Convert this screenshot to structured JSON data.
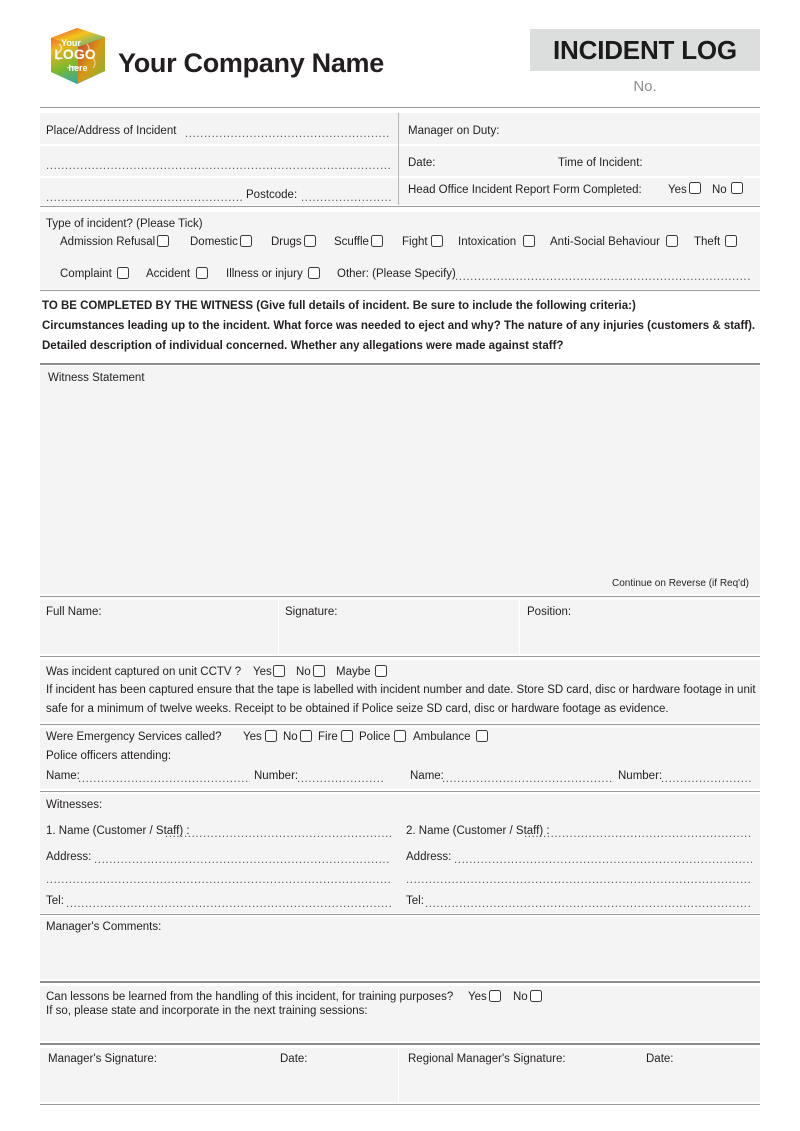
{
  "header": {
    "logo_alt": "Your LOGO here",
    "logo_line1": "Your",
    "logo_line2": "LOGO",
    "logo_line3": "here",
    "company_name": "Your Company Name",
    "badge_title": "INCIDENT LOG",
    "number_label": "No."
  },
  "dots": {
    "d1": "..........................................................................................................",
    "d2": "...............................................................................................................................................",
    "d3": "..............................................................................",
    "d4": ".....................................................",
    "d5": "............................................................................................................................................................................................",
    "d6": "..................................................................",
    "d7": ".................................",
    "d8": "............................................................................................................",
    "d9": "...................................................................................................................................",
    "d10": "..............................................................................................................................................."
  },
  "incident_info": {
    "place_label": "Place/Address of Incident",
    "postcode_label": "Postcode:",
    "manager_on_duty_label": "Manager on Duty:",
    "date_label": "Date:",
    "time_label": "Time of Incident:",
    "head_office_label": "Head Office Incident Report Form Completed:",
    "yes_label": "Yes",
    "no_label": "No"
  },
  "incident_type": {
    "title": "Type of incident? (Please Tick)",
    "row1": [
      {
        "label": "Admission Refusal"
      },
      {
        "label": "Domestic"
      },
      {
        "label": "Drugs"
      },
      {
        "label": "Scuffle"
      },
      {
        "label": "Fight"
      },
      {
        "label": "Intoxication"
      },
      {
        "label": "Anti-Social Behaviour"
      },
      {
        "label": "Theft"
      }
    ],
    "row2": [
      {
        "label": "Complaint"
      },
      {
        "label": "Accident"
      },
      {
        "label": "Illness or injury"
      }
    ],
    "other_label": "Other: (Please Specify)"
  },
  "instructions": {
    "line1": "TO BE COMPLETED BY THE WITNESS (Give full details of incident. Be sure to include the following criteria:)",
    "line2": "Circumstances leading up to the incident. What force was needed to eject and why? The nature of any injuries (customers & staff).",
    "line3": "Detailed description of individual concerned. Whether any allegations were made against staff?"
  },
  "witness_statement": {
    "title": "Witness Statement",
    "continue_note": "Continue on Reverse (if Req'd)"
  },
  "signature_row": {
    "full_name_label": "Full Name:",
    "signature_label": "Signature:",
    "position_label": "Position:"
  },
  "cctv": {
    "question": "Was incident captured on unit CCTV ?",
    "options": [
      {
        "label": "Yes"
      },
      {
        "label": "No"
      },
      {
        "label": "Maybe"
      }
    ],
    "note_line1": "If incident has been captured ensure that the tape is labelled with incident number and date. Store SD card, disc or hardware footage in unit",
    "note_line2": "safe for a minimum of twelve weeks. Receipt to be obtained if Police seize SD card, disc or hardware footage as evidence."
  },
  "emergency": {
    "question": "Were Emergency Services called?",
    "options": [
      {
        "label": "Yes"
      },
      {
        "label": "No"
      },
      {
        "label": "Fire"
      },
      {
        "label": "Police"
      },
      {
        "label": "Ambulance"
      }
    ],
    "officers_label": "Police officers attending:",
    "name_label": "Name:",
    "number_label": "Number:"
  },
  "witnesses": {
    "title": "Witnesses:",
    "entry1_label": "1. Name (Customer / Staff) :",
    "entry2_label": "2. Name (Customer / Staff) :",
    "address_label": "Address:",
    "tel_label": "Tel:"
  },
  "manager_comments": {
    "title": "Manager's Comments:"
  },
  "lessons": {
    "question": "Can lessons be learned from the handling of this incident, for training purposes?",
    "yes_label": "Yes",
    "no_label": "No",
    "followup": "If so, please state and incorporate in the next training sessions:"
  },
  "final_signatures": {
    "manager_signature_label": "Manager's Signature:",
    "manager_date_label": "Date:",
    "regional_signature_label": "Regional Manager's Signature:",
    "regional_date_label": "Date:"
  },
  "colors": {
    "panel_bg": "#f4f4f4",
    "badge_bg": "#dcdddd",
    "rule": "#9a9a9a",
    "text": "#231f20",
    "muted": "#8e8e8e"
  }
}
